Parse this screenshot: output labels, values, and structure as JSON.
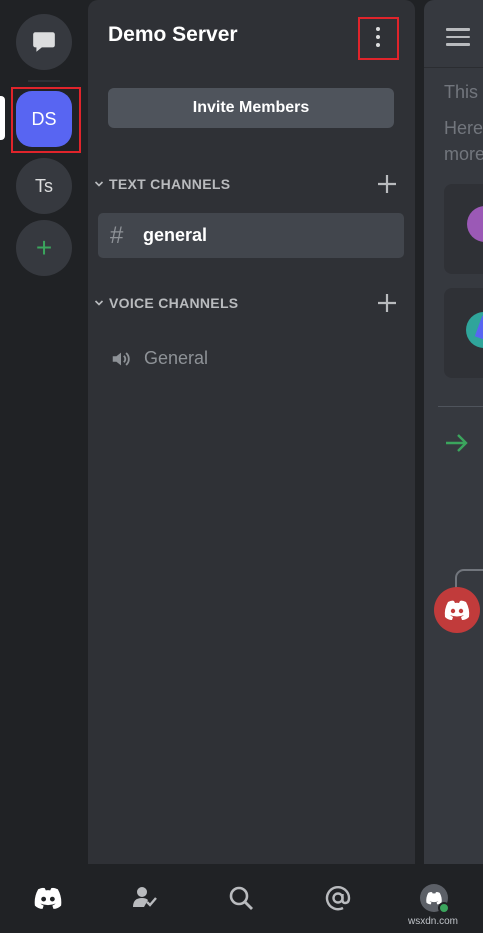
{
  "rail": {
    "servers": [
      {
        "initials": "DS",
        "name": "Demo Server",
        "active": true
      },
      {
        "initials": "Ts",
        "active": false
      }
    ],
    "add_server_label": "+"
  },
  "server": {
    "title": "Demo Server",
    "invite_label": "Invite Members",
    "categories": [
      {
        "label": "TEXT CHANNELS",
        "channels": [
          {
            "name": "general",
            "type": "text",
            "selected": true
          }
        ]
      },
      {
        "label": "VOICE CHANNELS",
        "channels": [
          {
            "name": "General",
            "type": "voice",
            "selected": false
          }
        ]
      }
    ]
  },
  "peek": {
    "line1": "This",
    "line2": "Here",
    "line3": "more"
  },
  "bottom_nav": {
    "items": [
      "home-icon",
      "friends-icon",
      "search-icon",
      "mentions-icon",
      "profile-avatar"
    ]
  },
  "watermark": "wsxdn.com",
  "colors": {
    "accent": "#5865f2",
    "online": "#3ba55d",
    "highlight": "#e0242b"
  }
}
